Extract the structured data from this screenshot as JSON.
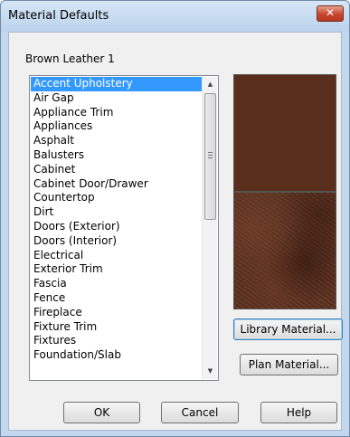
{
  "window": {
    "title": "Material Defaults",
    "close_label": "✕"
  },
  "material": {
    "name": "Brown Leather 1"
  },
  "list": {
    "items": [
      {
        "label": "Accent Upholstery"
      },
      {
        "label": "Air Gap"
      },
      {
        "label": "Appliance Trim"
      },
      {
        "label": "Appliances"
      },
      {
        "label": "Asphalt"
      },
      {
        "label": "Balusters"
      },
      {
        "label": "Cabinet"
      },
      {
        "label": "Cabinet Door/Drawer"
      },
      {
        "label": "Countertop"
      },
      {
        "label": "Dirt"
      },
      {
        "label": "Doors (Exterior)"
      },
      {
        "label": "Doors (Interior)"
      },
      {
        "label": "Electrical"
      },
      {
        "label": "Exterior Trim"
      },
      {
        "label": "Fascia"
      },
      {
        "label": "Fence"
      },
      {
        "label": "Fireplace"
      },
      {
        "label": "Fixture Trim"
      },
      {
        "label": "Fixtures"
      },
      {
        "label": "Foundation/Slab"
      }
    ],
    "selected": "Accent Upholstery",
    "scroll_up_icon": "▲",
    "scroll_down_icon": "▼"
  },
  "preview": {
    "flat_color": "#5a2e1c",
    "texture_base_color": "#5c2f1e"
  },
  "buttons": {
    "library_material": "Library Material...",
    "plan_material": "Plan Material...",
    "ok": "OK",
    "cancel": "Cancel",
    "help": "Help"
  }
}
